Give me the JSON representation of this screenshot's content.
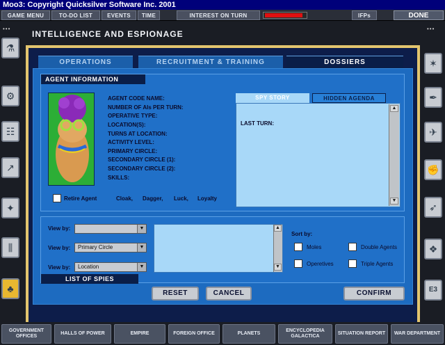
{
  "title": "Moo3: Copyright Quicksilver Software Inc. 2001",
  "top_menu": {
    "items": [
      "GAME MENU",
      "TO-DO LIST",
      "EVENTS",
      "TIME",
      "INTEREST ON TURN",
      "IFPs"
    ],
    "done": "DONE",
    "interest_level": 0.9
  },
  "page_title": "INTELLIGENCE AND ESPIONAGE",
  "tabs": [
    "OPERATIONS",
    "RECRUITMENT & TRAINING",
    "DOSSIERS"
  ],
  "agent": {
    "header": "AGENT INFORMATION",
    "fields": [
      "AGENT CODE NAME:",
      "NUMBER OF AIs PER TURN:",
      "OPERATIVE TYPE:",
      "LOCATION(S):",
      "TURNS AT LOCATION:",
      "ACTIVITY LEVEL:",
      "PRIMARY CIRCLE:",
      "SECONDARY CIRCLE (1):",
      "SECONDARY CIRCLE (2):",
      "SKILLS:"
    ],
    "retire": "Retire Agent",
    "attributes": [
      "Cloak,",
      "Dagger,",
      "Luck,",
      "Loyalty"
    ]
  },
  "story": {
    "tabs": [
      "SPY STORY",
      "HIDDEN AGENDA"
    ],
    "last_turn": "LAST TURN:"
  },
  "spies": {
    "view_label": "View by:",
    "view_values": [
      "",
      "Primary Circle",
      "Location"
    ],
    "sort_label": "Sort by:",
    "sort_options": [
      "Moles",
      "Double Agents",
      "Operetives",
      "Triple Agents"
    ],
    "footer": "LIST OF SPIES"
  },
  "buttons": {
    "reset": "RESET",
    "cancel": "CANCEL",
    "confirm": "CONFIRM"
  },
  "right_side_label": "E3",
  "bottom_nav": [
    "GOVERNMENT OFFICES",
    "HALLS OF POWER",
    "EMPIRE",
    "FOREIGN OFFICE",
    "PLANETS",
    "ENCYCLOPEDIA GALACTICA",
    "SITUATION REPORT",
    "WAR DEPARTMENT"
  ],
  "colors": {
    "accent_gold": "#e3c56e",
    "panel_blue": "#2070c8",
    "dark_navy": "#0a1e48",
    "interest_red": "#e01010"
  }
}
